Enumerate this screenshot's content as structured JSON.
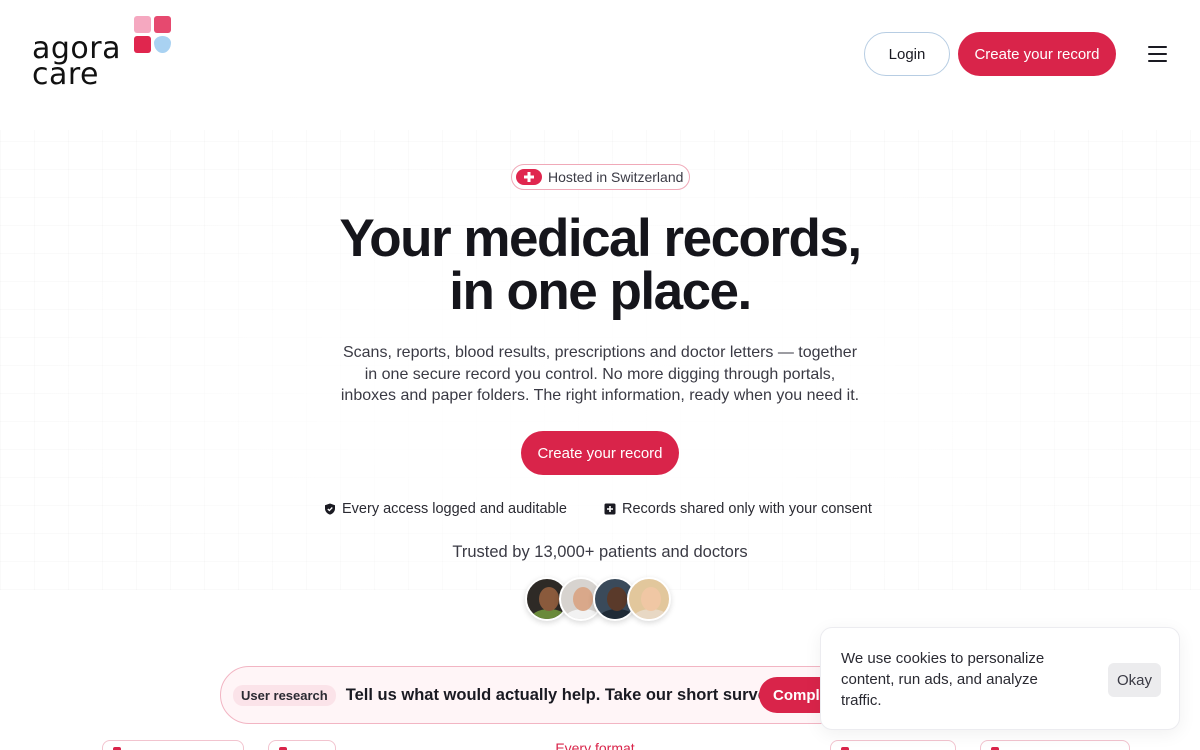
{
  "header": {
    "logo_text": "agora care",
    "login_label": "Login",
    "create_label": "Create your record"
  },
  "hero": {
    "badge_text": "Hosted in Switzerland",
    "title_line1": "Your medical records,",
    "title_line2": "in one place.",
    "subtitle": "Scans, reports, blood results, prescriptions and doctor letters — together in one secure record you control. No more digging through portals, inboxes and paper folders. The right information, ready when you need it.",
    "cta_label": "Create your record",
    "features": [
      {
        "icon": "shield-check-icon",
        "text": "Every access logged and auditable"
      },
      {
        "icon": "plus-square-icon",
        "text": "Records shared only with your consent"
      }
    ],
    "trusted_text": "Trusted by 13,000+ patients and doctors"
  },
  "survey": {
    "tag": "User research",
    "message": "Tell us what would actually help. Take our short survey.",
    "button_label": "Complete"
  },
  "strip": {
    "center_label": "Every format"
  },
  "cookie": {
    "text": "We use cookies to personalize content, run ads, and analyze traffic.",
    "okay_label": "Okay"
  },
  "colors": {
    "brand": "#d9244a",
    "brand_light": "#fff5f7"
  }
}
